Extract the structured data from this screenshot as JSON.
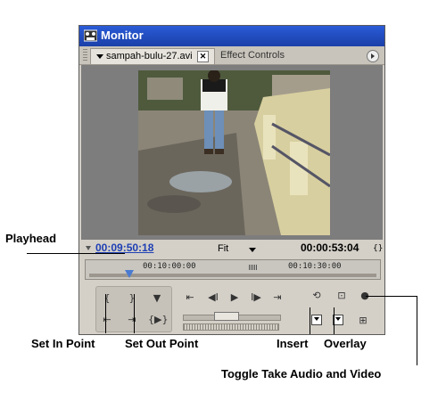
{
  "window": {
    "title": "Monitor",
    "tabs": [
      {
        "label": "sampah-bulu-27.avi",
        "active": true
      },
      {
        "label": "Effect Controls",
        "active": false
      }
    ]
  },
  "timecode": {
    "current": "00:09:50:18",
    "zoom": "Fit",
    "duration": "00:00:53:04"
  },
  "ruler": {
    "labels": [
      "00:10:00:00",
      "00:10:30:00"
    ]
  },
  "icons": {
    "title": "monitor-app-icon",
    "set_in": "set-in-point-icon",
    "set_out": "set-out-point-icon",
    "set_unnumbered_marker": "marker-icon",
    "go_to_in": "go-to-in-point-icon",
    "go_to_out": "go-to-out-point-icon",
    "play_in_to_out": "play-in-to-out-icon",
    "step_back": "step-back-icon",
    "play": "play-icon",
    "step_forward": "step-forward-icon",
    "go_to_out_point": "go-to-out-point-icon",
    "loop": "loop-icon",
    "safe_margins": "safe-margins-icon",
    "output": "output-icon",
    "insert": "insert-icon",
    "overlay": "overlay-icon",
    "toggle_take": "toggle-take-icon"
  },
  "callouts": {
    "playhead": "Playhead",
    "set_in_point": "Set In Point",
    "set_out_point": "Set Out Point",
    "insert": "Insert",
    "overlay": "Overlay",
    "toggle_take": "Toggle Take Audio and Video"
  },
  "colors": {
    "title_bar": "#1a3fa8",
    "timecode_current": "#1f3fb4",
    "panel": "#d4d0c8"
  }
}
